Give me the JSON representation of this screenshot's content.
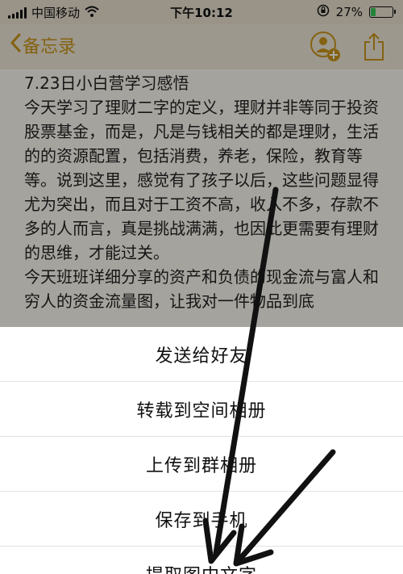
{
  "status_bar": {
    "carrier": "中国移动",
    "time": "下午10:12",
    "battery_percent": "27%",
    "battery_level": 0.27,
    "battery_color": "#34c759"
  },
  "nav": {
    "back_label": "备忘录",
    "accent_color": "#c8951a",
    "icons": [
      "add-person-icon",
      "share-icon"
    ]
  },
  "note": {
    "title": "7.23日小白营学习感悟",
    "paragraphs": [
      "今天学习了理财二字的定义，理财并非等同于投资股票基金，而是，凡是与钱相关的都是理财，生活的的资源配置，包括消费，养老，保险，教育等等。说到这里，感觉有了孩子以后，这些问题显得尤为突出，而且对于工资不高，收入不多，存款不多的人而言，真是挑战满满，也因此更需要有理财的思维，才能过关。",
      "今天班班详细分享的资产和负债的现金流与富人和穷人的资金流量图，让我对一件物品到底"
    ]
  },
  "action_sheet": {
    "items": [
      "发送给好友",
      "转载到空间相册",
      "上传到群相册",
      "保存到手机",
      "提取图中文字"
    ]
  }
}
